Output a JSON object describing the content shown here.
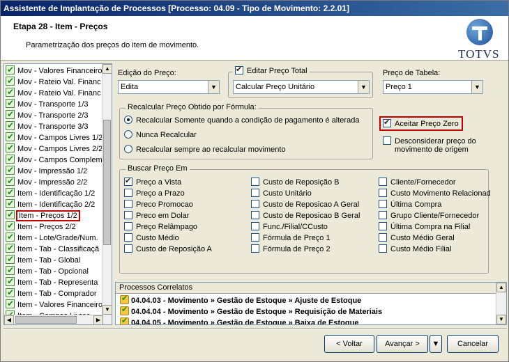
{
  "window": {
    "title": "Assistente de Implantação de Processos [Processo: 04.09 - Tipo de Movimento: 2.2.01]"
  },
  "header": {
    "step_title": "Etapa 28 - Item - Preços",
    "subtitle": "Parametrização dos preços do item de movimento.",
    "logo_text": "TOTVS"
  },
  "tree": {
    "items": [
      "Mov - Valores Financeiro",
      "Mov - Rateio Val. Financ",
      "Mov - Rateio Val. Financ",
      "Mov - Transporte 1/3",
      "Mov - Transporte 2/3",
      "Mov - Transporte 3/3",
      "Mov - Campos Livres 1/2",
      "Mov - Campos Livres 2/2",
      "Mov - Campos Complem",
      "Mov - Impressão 1/2",
      "Mov - Impressão 2/2",
      "Item - Identificação 1/2",
      "Item - Identificação 2/2",
      "Item - Preços 1/2",
      "Item - Preços 2/2",
      "Item - Lote/Grade/Num.",
      "Item - Tab - Classificaçã",
      "Item - Tab - Global",
      "Item - Tab - Opcional",
      "Item - Tab - Representa",
      "Item - Tab - Comprador",
      "Item - Valores Financeiro",
      "Item - Campos Livres"
    ],
    "selected_index": 13
  },
  "form": {
    "edicao_label": "Edição do Preço:",
    "edicao_value": "Edita",
    "editar_total_label": "Editar Preço Total",
    "editar_total_checked": true,
    "editar_total_value": "Calcular Preço Unitário",
    "tabela_label": "Preço de Tabela:",
    "tabela_value": "Preço 1",
    "recalcular_group": "Recalcular Preço Obtido por Fórmula:",
    "recalcular_options": [
      "Recalcular Somente quando a condição de pagamento é alterada",
      "Nunca Recalcular",
      "Recalcular sempre ao recalcular movimento"
    ],
    "recalcular_selected": 0,
    "aceitar_zero_label": "Aceitar Preço Zero",
    "aceitar_zero_checked": true,
    "desconsiderar_line1": "Desconsiderar preço do",
    "desconsiderar_line2": "movimento de origem",
    "desconsiderar_checked": false
  },
  "buscar": {
    "title": "Buscar Preço Em",
    "col1": [
      "Preço a Vista",
      "Preço a Prazo",
      "Preco Promocao",
      "Preco em Dolar",
      "Preço Relâmpago",
      "Custo Médio",
      "Custo de Reposição A"
    ],
    "col2": [
      "Custo de Reposição B",
      "Custo Unitário",
      "Custo de Reposicao A Geral",
      "Custo de Reposicao B Geral",
      "Func./Filial/CCusto",
      "Fórmula de Preço 1",
      "Fórmula de Preço 2"
    ],
    "col3": [
      "Cliente/Fornecedor",
      "Custo Movimento Relacionad",
      "Última Compra",
      "Grupo Cliente/Fornecedor",
      "Última Compra na Filial",
      "Custo Médio Geral",
      "Custo Médio Filial"
    ],
    "checked": [
      "Preço a Vista"
    ]
  },
  "processos": {
    "title": "Processos Correlatos",
    "items": [
      "04.04.03 - Movimento » Gestão de Estoque » Ajuste de Estoque",
      "04.04.04 - Movimento » Gestão de Estoque » Requisição de Materiais",
      "04.04.05 - Movimento » Gestão de Estoque » Baixa de Estoque"
    ]
  },
  "buttons": {
    "back": "< Voltar",
    "next": "Avançar >",
    "cancel": "Cancelar"
  },
  "colors": {
    "highlight": "#c00000",
    "titlebar": "#0a246a"
  }
}
